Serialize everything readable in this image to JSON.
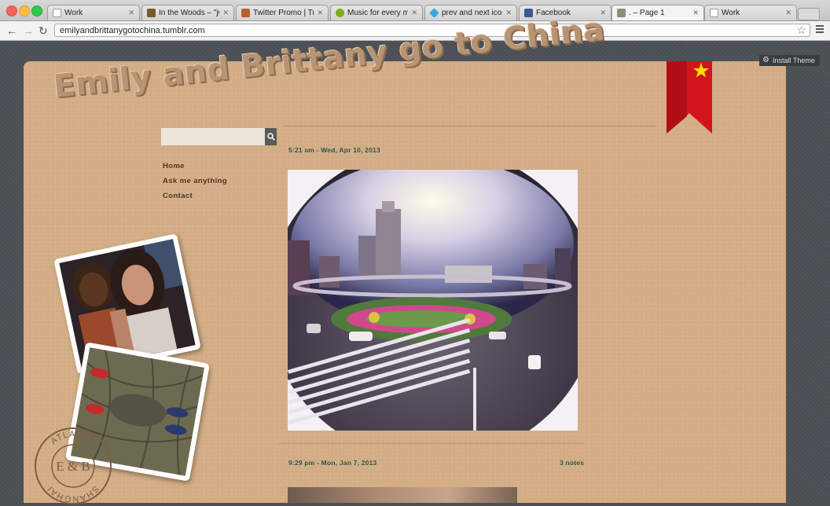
{
  "browser": {
    "tabs": [
      {
        "title": "Work",
        "icon": "document-icon",
        "active": false
      },
      {
        "title": "In the Woods – \"jQu",
        "icon": "site-icon",
        "active": false
      },
      {
        "title": "Twitter Promo | Tum",
        "icon": "site-icon",
        "active": false
      },
      {
        "title": "Music for every mom",
        "icon": "music-icon",
        "active": false
      },
      {
        "title": "prev and next icons",
        "icon": "diamond-icon",
        "active": false
      },
      {
        "title": "Facebook",
        "icon": "facebook-icon",
        "active": false
      },
      {
        "title": ". – Page 1",
        "icon": "site-icon",
        "active": true
      },
      {
        "title": "Work",
        "icon": "document-icon",
        "active": false
      }
    ],
    "url": "emilyandbrittanygotochina.tumblr.com"
  },
  "blog": {
    "install_theme": "Install Theme",
    "title": "Emily and Brittany go to China",
    "search_placeholder": "",
    "nav": [
      "Home",
      "Ask me anything",
      "Contact"
    ],
    "posts": [
      {
        "timestamp": "5:21 am - Wed, Apr 10, 2013",
        "notes": ""
      },
      {
        "timestamp": "9:29 pm - Mon, Jan 7, 2013",
        "notes": "3 notes"
      }
    ],
    "stamp": {
      "top": "ATLANTA",
      "bottom": "SHANGHAI",
      "center": "E & B"
    }
  },
  "colors": {
    "paper": "#d4ae86",
    "background": "#4b5056",
    "ribbon_red": "#d3141c",
    "link": "#4a2f20",
    "meta": "#2b5249"
  }
}
